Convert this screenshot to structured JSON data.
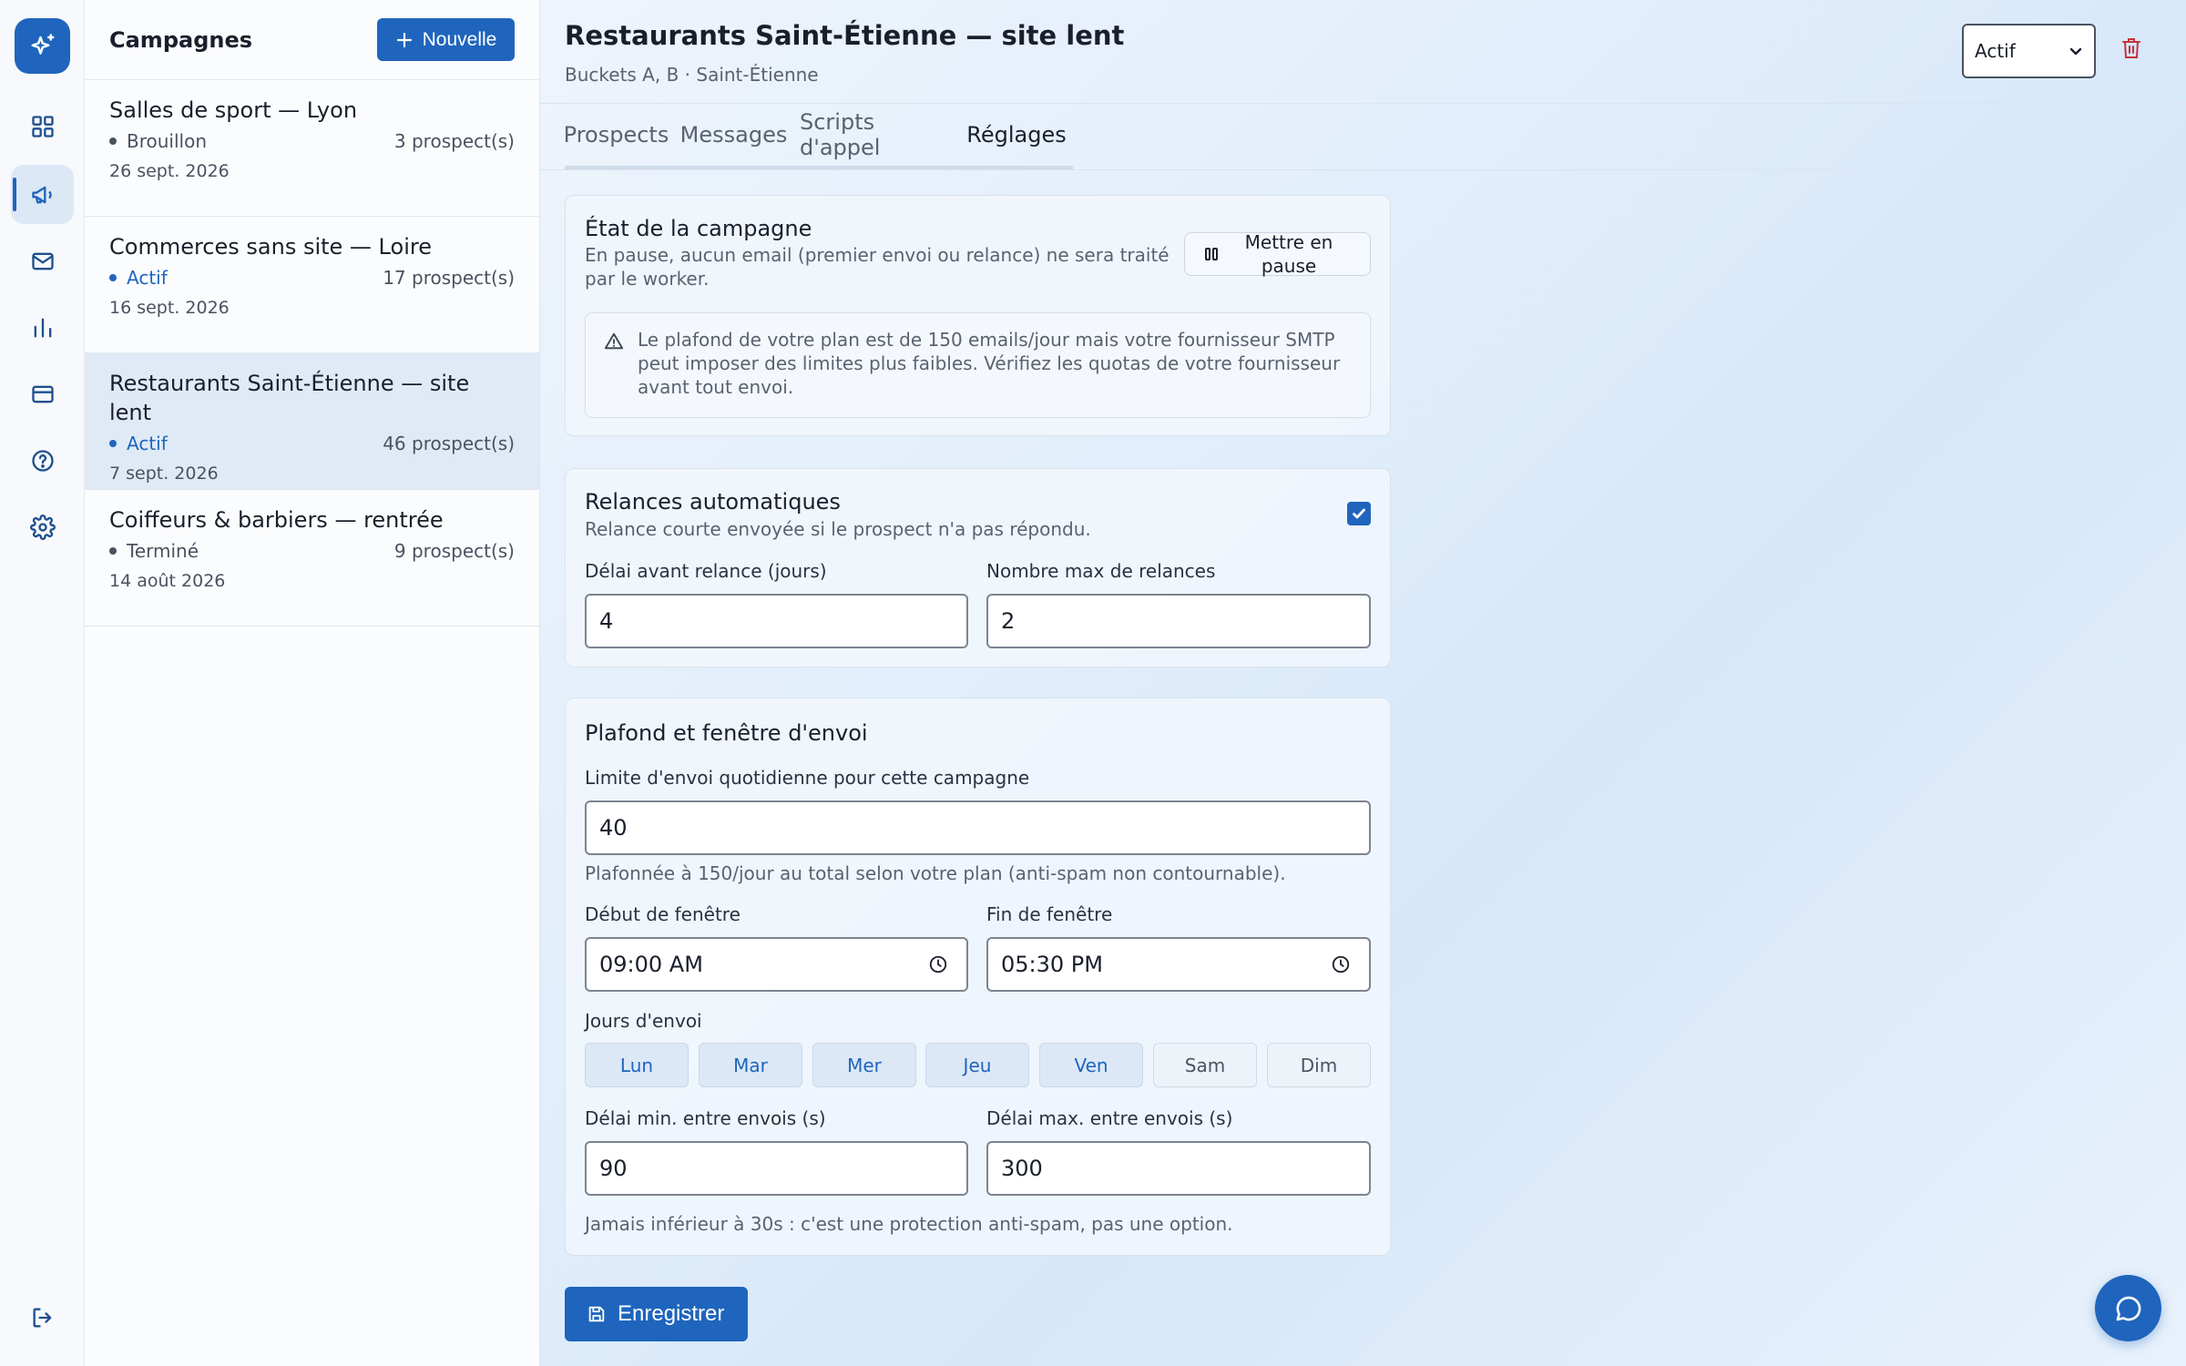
{
  "list": {
    "title": "Campagnes",
    "new_label": "Nouvelle",
    "items": [
      {
        "name": "Salles de sport — Lyon",
        "status": "Brouillon",
        "count": "3 prospect(s)",
        "date": "26 sept. 2026"
      },
      {
        "name": "Commerces sans site — Loire",
        "status": "Actif",
        "count": "17 prospect(s)",
        "date": "16 sept. 2026"
      },
      {
        "name": "Restaurants Saint-Étienne — site lent",
        "status": "Actif",
        "count": "46 prospect(s)",
        "date": "7 sept. 2026"
      },
      {
        "name": "Coiffeurs & barbiers — rentrée",
        "status": "Terminé",
        "count": "9 prospect(s)",
        "date": "14 août 2026"
      }
    ]
  },
  "header": {
    "title": "Restaurants Saint-Étienne — site lent",
    "subtitle": "Buckets A, B · Saint-Étienne",
    "status_value": "Actif"
  },
  "tabs": [
    "Prospects",
    "Messages",
    "Scripts d'appel",
    "Réglages"
  ],
  "state_card": {
    "title": "État de la campagne",
    "desc": "En pause, aucun email (premier envoi ou relance) ne sera traité par le worker.",
    "pause_label": "Mettre en pause",
    "warning": "Le plafond de votre plan est de 150 emails/jour mais votre fournisseur SMTP peut imposer des limites plus faibles. Vérifiez les quotas de votre fournisseur avant tout envoi."
  },
  "followup_card": {
    "title": "Relances automatiques",
    "desc": "Relance courte envoyée si le prospect n'a pas répondu.",
    "enabled": true,
    "delay_label": "Délai avant relance (jours)",
    "delay_value": "4",
    "max_label": "Nombre max de relances",
    "max_value": "2"
  },
  "window_card": {
    "title": "Plafond et fenêtre d'envoi",
    "daily_label": "Limite d'envoi quotidienne pour cette campagne",
    "daily_value": "40",
    "daily_hint": "Plafonnée à 150/jour au total selon votre plan (anti-spam non contournable).",
    "start_label": "Début de fenêtre",
    "start_value": "09:00 AM",
    "end_label": "Fin de fenêtre",
    "end_value": "05:30 PM",
    "days_label": "Jours d'envoi",
    "days": [
      "Lun",
      "Mar",
      "Mer",
      "Jeu",
      "Ven",
      "Sam",
      "Dim"
    ],
    "min_label": "Délai min. entre envois (s)",
    "min_value": "90",
    "max_label": "Délai max. entre envois (s)",
    "max_value": "300",
    "hint": "Jamais inférieur à 30s : c'est une protection anti-spam, pas une option."
  },
  "save_label": "Enregistrer",
  "colors": {
    "accent": "#1f65bd",
    "danger": "#c8323b"
  }
}
